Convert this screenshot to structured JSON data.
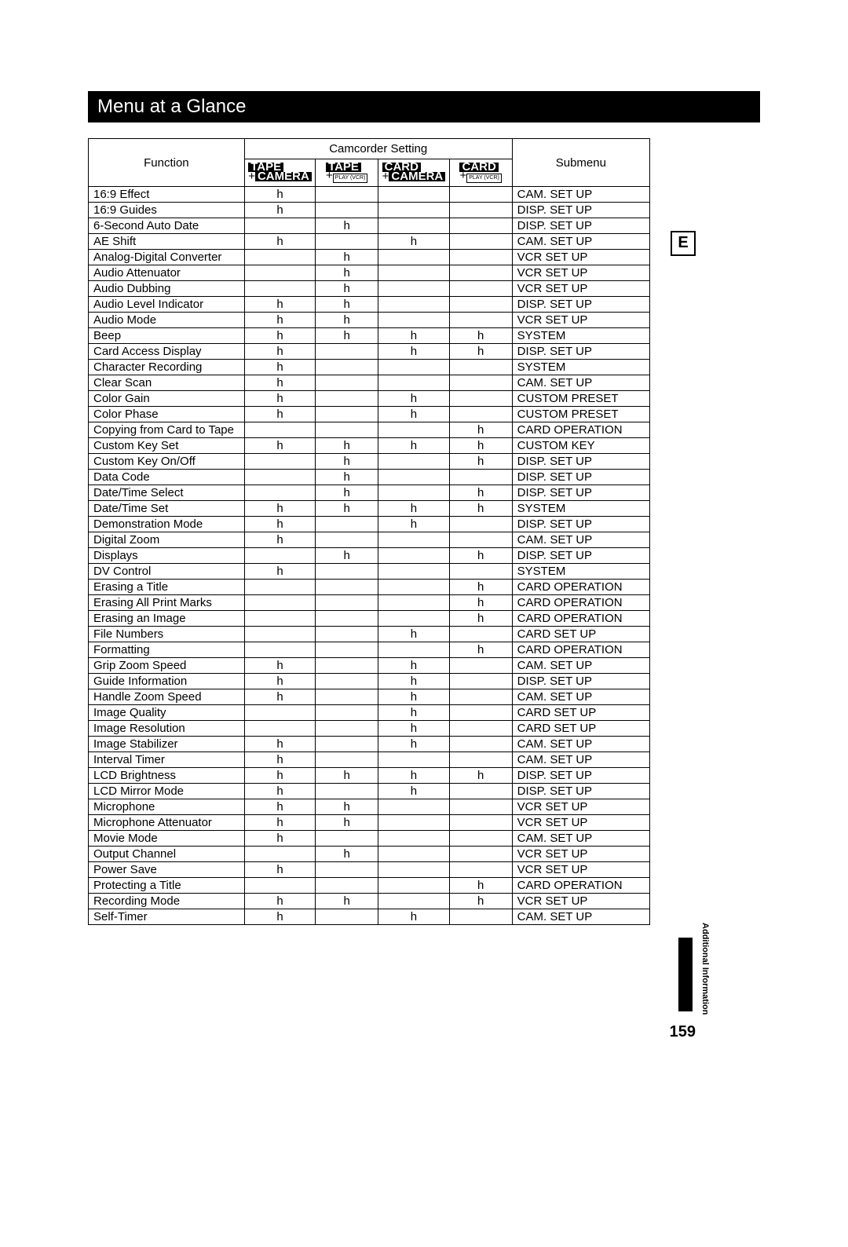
{
  "page_title": "Menu at a Glance",
  "right_letter": "E",
  "page_number": "159",
  "side_text": "Additional Information",
  "headers": {
    "function": "Function",
    "setting_group": "Camcorder Setting",
    "submenu": "Submenu",
    "mode1_top": "TAPE",
    "mode1_bottom": "CAMERA",
    "mode2_top": "TAPE",
    "mode2_bottom": "PLAY (VCR)",
    "mode3_top": "CARD",
    "mode3_bottom": "CAMERA",
    "mode4_top": "CARD",
    "mode4_bottom": "PLAY (VCR)"
  },
  "mark": "h",
  "rows": [
    {
      "func": "16:9 Effect",
      "m": [
        1,
        0,
        0,
        0
      ],
      "sub": "CAM. SET UP"
    },
    {
      "func": "16:9 Guides",
      "m": [
        1,
        0,
        0,
        0
      ],
      "sub": "DISP. SET UP"
    },
    {
      "func": "6-Second Auto Date",
      "m": [
        0,
        1,
        0,
        0
      ],
      "sub": "DISP. SET UP"
    },
    {
      "func": "AE Shift",
      "m": [
        1,
        0,
        1,
        0
      ],
      "sub": "CAM. SET UP"
    },
    {
      "func": "Analog-Digital Converter",
      "m": [
        0,
        1,
        0,
        0
      ],
      "sub": "VCR SET UP"
    },
    {
      "func": "Audio Attenuator",
      "m": [
        0,
        1,
        0,
        0
      ],
      "sub": "VCR SET UP"
    },
    {
      "func": "Audio Dubbing",
      "m": [
        0,
        1,
        0,
        0
      ],
      "sub": "VCR SET UP"
    },
    {
      "func": "Audio Level Indicator",
      "m": [
        1,
        1,
        0,
        0
      ],
      "sub": "DISP. SET UP"
    },
    {
      "func": "Audio Mode",
      "m": [
        1,
        1,
        0,
        0
      ],
      "sub": "VCR SET UP"
    },
    {
      "func": "Beep",
      "m": [
        1,
        1,
        1,
        1
      ],
      "sub": "SYSTEM"
    },
    {
      "func": "Card Access Display",
      "m": [
        1,
        0,
        1,
        1
      ],
      "sub": "DISP. SET UP"
    },
    {
      "func": "Character Recording",
      "m": [
        1,
        0,
        0,
        0
      ],
      "sub": "SYSTEM"
    },
    {
      "func": "Clear Scan",
      "m": [
        1,
        0,
        0,
        0
      ],
      "sub": "CAM. SET UP"
    },
    {
      "func": "Color Gain",
      "m": [
        1,
        0,
        1,
        0
      ],
      "sub": "CUSTOM PRESET"
    },
    {
      "func": "Color Phase",
      "m": [
        1,
        0,
        1,
        0
      ],
      "sub": "CUSTOM PRESET"
    },
    {
      "func": "Copying from Card to Tape",
      "m": [
        0,
        0,
        0,
        1
      ],
      "sub": "CARD OPERATION"
    },
    {
      "func": "Custom Key Set",
      "m": [
        1,
        1,
        1,
        1
      ],
      "sub": "CUSTOM KEY"
    },
    {
      "func": "Custom Key On/Off",
      "m": [
        0,
        1,
        0,
        1
      ],
      "sub": "DISP. SET UP"
    },
    {
      "func": "Data Code",
      "m": [
        0,
        1,
        0,
        0
      ],
      "sub": "DISP. SET UP"
    },
    {
      "func": "Date/Time Select",
      "m": [
        0,
        1,
        0,
        1
      ],
      "sub": "DISP. SET UP"
    },
    {
      "func": "Date/Time Set",
      "m": [
        1,
        1,
        1,
        1
      ],
      "sub": "SYSTEM"
    },
    {
      "func": "Demonstration Mode",
      "m": [
        1,
        0,
        1,
        0
      ],
      "sub": "DISP. SET UP"
    },
    {
      "func": "Digital Zoom",
      "m": [
        1,
        0,
        0,
        0
      ],
      "sub": "CAM. SET UP"
    },
    {
      "func": "Displays",
      "m": [
        0,
        1,
        0,
        1
      ],
      "sub": "DISP. SET UP"
    },
    {
      "func": "DV Control",
      "m": [
        1,
        0,
        0,
        0
      ],
      "sub": "SYSTEM"
    },
    {
      "func": "Erasing a Title",
      "m": [
        0,
        0,
        0,
        1
      ],
      "sub": "CARD OPERATION"
    },
    {
      "func": "Erasing All Print Marks",
      "m": [
        0,
        0,
        0,
        1
      ],
      "sub": "CARD OPERATION"
    },
    {
      "func": "Erasing an Image",
      "m": [
        0,
        0,
        0,
        1
      ],
      "sub": "CARD OPERATION"
    },
    {
      "func": "File Numbers",
      "m": [
        0,
        0,
        1,
        0
      ],
      "sub": "CARD SET UP"
    },
    {
      "func": "Formatting",
      "m": [
        0,
        0,
        0,
        1
      ],
      "sub": "CARD OPERATION"
    },
    {
      "func": "Grip Zoom Speed",
      "m": [
        1,
        0,
        1,
        0
      ],
      "sub": "CAM. SET UP"
    },
    {
      "func": "Guide Information",
      "m": [
        1,
        0,
        1,
        0
      ],
      "sub": "DISP. SET UP"
    },
    {
      "func": "Handle Zoom Speed",
      "m": [
        1,
        0,
        1,
        0
      ],
      "sub": "CAM. SET UP"
    },
    {
      "func": "Image Quality",
      "m": [
        0,
        0,
        1,
        0
      ],
      "sub": "CARD SET UP"
    },
    {
      "func": "Image Resolution",
      "m": [
        0,
        0,
        1,
        0
      ],
      "sub": "CARD SET UP"
    },
    {
      "func": "Image Stabilizer",
      "m": [
        1,
        0,
        1,
        0
      ],
      "sub": "CAM. SET UP"
    },
    {
      "func": "Interval Timer",
      "m": [
        1,
        0,
        0,
        0
      ],
      "sub": "CAM. SET UP"
    },
    {
      "func": "LCD Brightness",
      "m": [
        1,
        1,
        1,
        1
      ],
      "sub": "DISP. SET UP"
    },
    {
      "func": "LCD Mirror Mode",
      "m": [
        1,
        0,
        1,
        0
      ],
      "sub": "DISP. SET UP"
    },
    {
      "func": "Microphone",
      "m": [
        1,
        1,
        0,
        0
      ],
      "sub": "VCR SET UP"
    },
    {
      "func": "Microphone Attenuator",
      "m": [
        1,
        1,
        0,
        0
      ],
      "sub": "VCR SET UP"
    },
    {
      "func": "Movie Mode",
      "m": [
        1,
        0,
        0,
        0
      ],
      "sub": "CAM. SET UP"
    },
    {
      "func": "Output Channel",
      "m": [
        0,
        1,
        0,
        0
      ],
      "sub": "VCR SET UP"
    },
    {
      "func": "Power Save",
      "m": [
        1,
        0,
        0,
        0
      ],
      "sub": "VCR SET UP"
    },
    {
      "func": "Protecting a Title",
      "m": [
        0,
        0,
        0,
        1
      ],
      "sub": "CARD OPERATION"
    },
    {
      "func": "Recording Mode",
      "m": [
        1,
        1,
        0,
        1
      ],
      "sub": "VCR SET UP"
    },
    {
      "func": "Self-Timer",
      "m": [
        1,
        0,
        1,
        0
      ],
      "sub": "CAM. SET UP"
    }
  ]
}
